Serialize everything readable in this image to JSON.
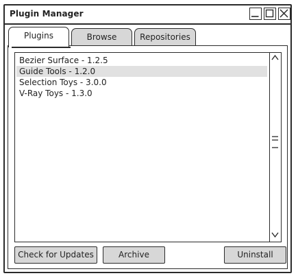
{
  "window": {
    "title": "Plugin Manager"
  },
  "tabs": [
    {
      "label": "Plugins",
      "active": true
    },
    {
      "label": "Browse",
      "active": false
    },
    {
      "label": "Repositories",
      "active": false
    }
  ],
  "plugins": [
    {
      "label": "Bezier Surface - 1.2.5",
      "selected": false
    },
    {
      "label": "Guide Tools - 1.2.0",
      "selected": true
    },
    {
      "label": "Selection Toys - 3.0.0",
      "selected": false
    },
    {
      "label": "V-Ray Toys - 1.3.0",
      "selected": false
    }
  ],
  "buttons": {
    "check_updates": "Check for Updates",
    "archive": "Archive",
    "uninstall": "Uninstall"
  },
  "colors": {
    "outline": "#2a2a2a",
    "button_fill": "#d7d7d7",
    "selection": "#e1e1e1"
  }
}
